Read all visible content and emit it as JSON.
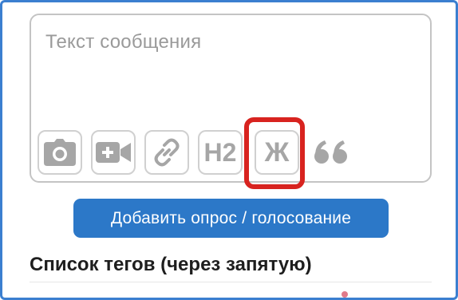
{
  "message": {
    "placeholder": "Текст сообщения"
  },
  "toolbar": {
    "buttons": [
      {
        "name": "photo",
        "icon": "camera-icon"
      },
      {
        "name": "video",
        "icon": "video-camera-icon"
      },
      {
        "name": "link",
        "icon": "link-icon"
      },
      {
        "name": "heading",
        "label": "H2"
      },
      {
        "name": "bold",
        "label": "Ж",
        "highlighted": true
      },
      {
        "name": "quote",
        "label": "❝"
      }
    ],
    "highlight_color": "#d8231f"
  },
  "poll_button": {
    "label": "Добавить опрос / голосование",
    "color": "#2c78c8"
  },
  "tags": {
    "label": "Список тегов (через запятую)"
  }
}
